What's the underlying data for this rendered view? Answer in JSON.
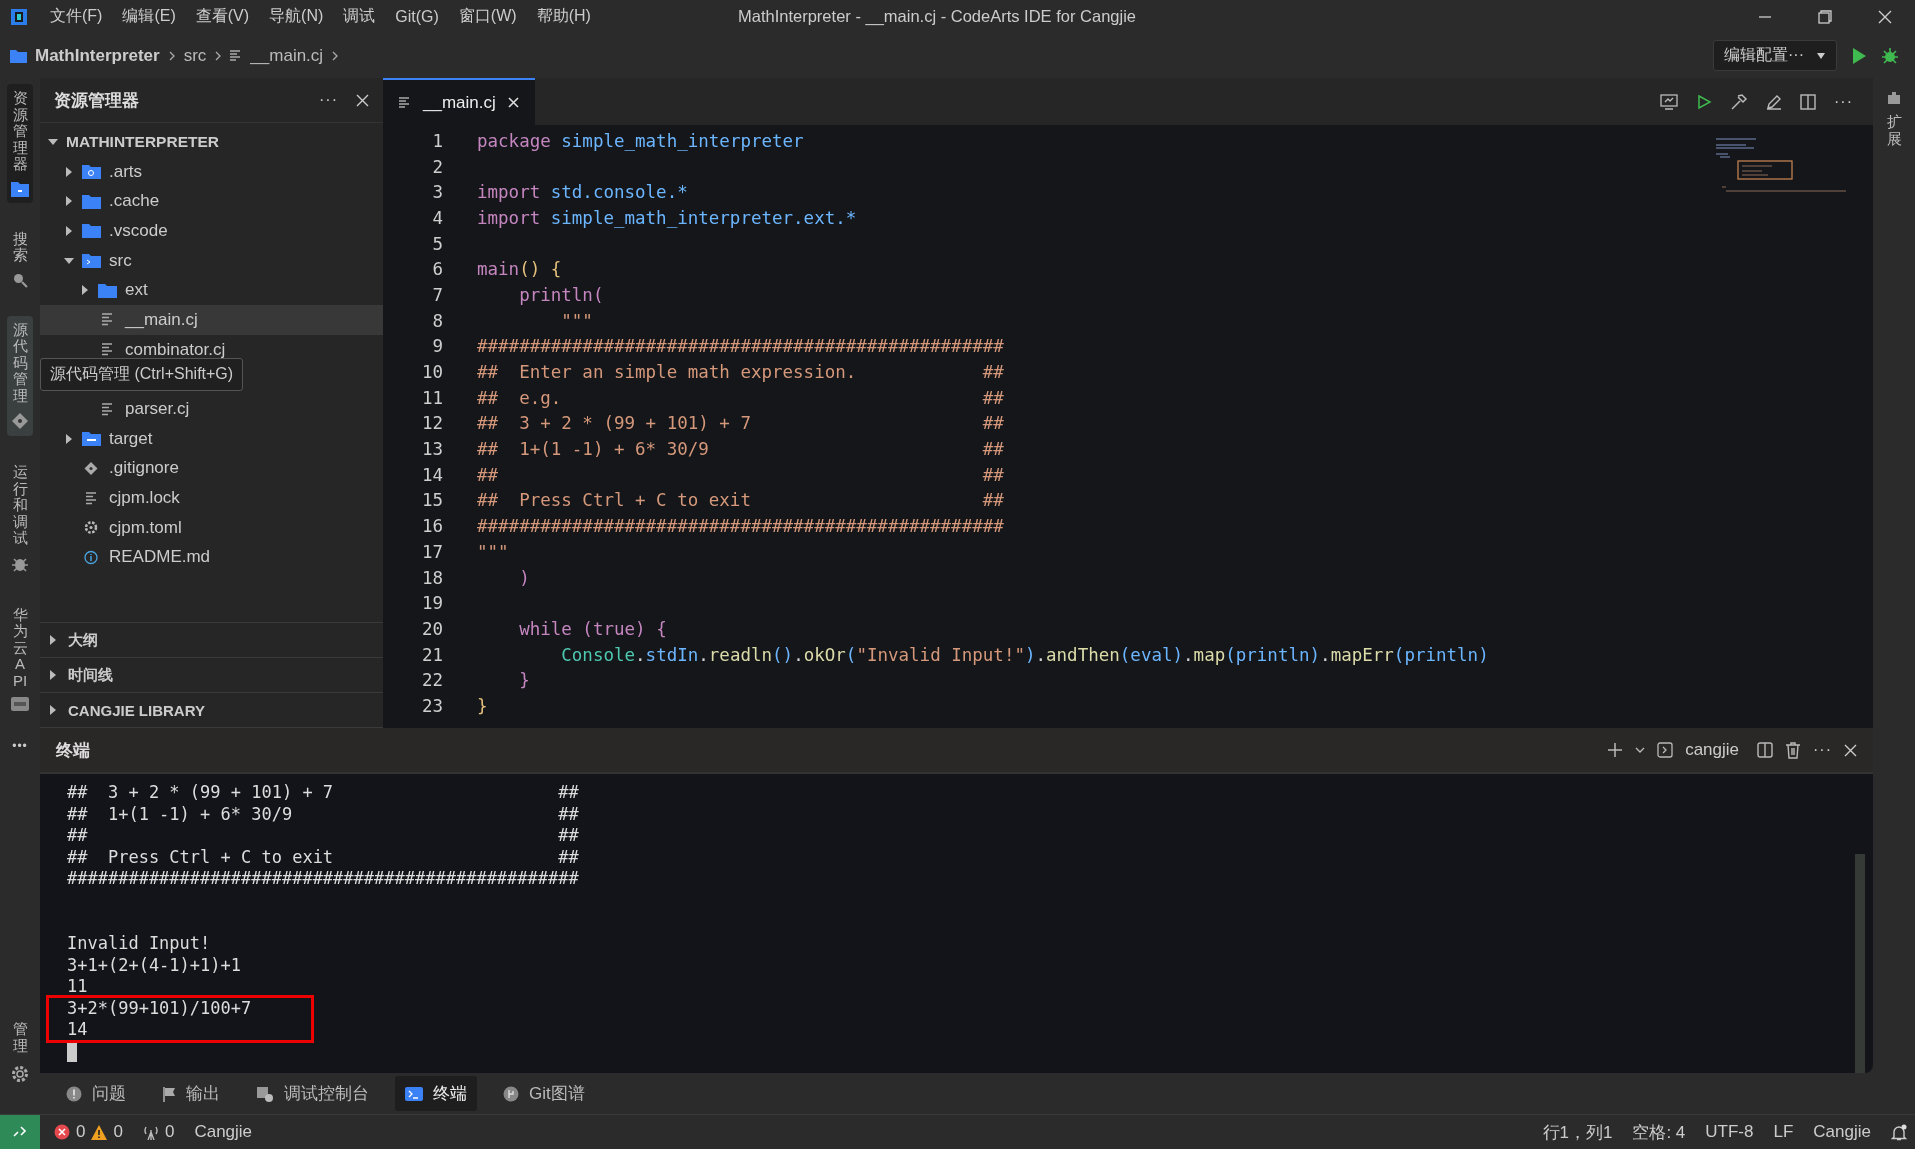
{
  "title_bar": {
    "menus": [
      "文件(F)",
      "编辑(E)",
      "查看(V)",
      "导航(N)",
      "调试",
      "Git(G)",
      "窗口(W)",
      "帮助(H)"
    ],
    "title": "MathInterpreter - __main.cj - CodeArts IDE for Cangjie"
  },
  "breadcrumb": {
    "items": [
      {
        "label": "MathInterpreter",
        "kind": "project"
      },
      {
        "label": "src",
        "kind": "folder"
      },
      {
        "label": "__main.cj",
        "kind": "file"
      }
    ],
    "config_button": "编辑配置···"
  },
  "activity_bar": {
    "items": [
      {
        "label": "资源管理器",
        "selected": true,
        "hovered": false
      },
      {
        "label": "搜索",
        "selected": false,
        "hovered": false
      },
      {
        "label": "源代码管理",
        "selected": false,
        "hovered": true
      },
      {
        "label": "运行和调试",
        "selected": false,
        "hovered": false
      },
      {
        "label": "华为云 API",
        "selected": false,
        "hovered": false
      }
    ],
    "more": "•••",
    "bottom": {
      "label": "管理"
    },
    "tooltip": "源代码管理 (Ctrl+Shift+G)"
  },
  "right_bar": {
    "label": "扩展"
  },
  "explorer": {
    "title": "资源管理器",
    "more": "···",
    "root": {
      "label": "MATHINTERPRETER",
      "expanded": true,
      "children": [
        {
          "label": ".arts",
          "kind": "folder-arts",
          "expanded": false,
          "selected": false
        },
        {
          "label": ".cache",
          "kind": "folder",
          "expanded": false,
          "selected": false
        },
        {
          "label": ".vscode",
          "kind": "folder",
          "expanded": false,
          "selected": false
        },
        {
          "label": "src",
          "kind": "folder-src",
          "expanded": true,
          "selected": false,
          "children": [
            {
              "label": "ext",
              "kind": "folder",
              "expanded": false,
              "selected": false
            },
            {
              "label": "__main.cj",
              "kind": "file",
              "selected": true
            },
            {
              "label": "combinator.cj",
              "kind": "file",
              "selected": false
            },
            {
              "kind": "covered"
            },
            {
              "label": "parser.cj",
              "kind": "file",
              "selected": false
            }
          ]
        },
        {
          "label": "target",
          "kind": "folder-target",
          "expanded": false,
          "selected": false
        },
        {
          "label": ".gitignore",
          "kind": "git",
          "selected": false
        },
        {
          "label": "cjpm.lock",
          "kind": "file",
          "selected": false
        },
        {
          "label": "cjpm.toml",
          "kind": "gear",
          "selected": false
        },
        {
          "label": "README.md",
          "kind": "info",
          "selected": false
        }
      ]
    },
    "sections": [
      {
        "label": "大纲",
        "expanded": false
      },
      {
        "label": "时间线",
        "expanded": false
      },
      {
        "label": "CANGJIE LIBRARY",
        "expanded": false
      }
    ]
  },
  "editor": {
    "tabs": [
      {
        "label": "__main.cj",
        "selected": true
      }
    ],
    "more": "···",
    "lines": [
      {
        "number": "1",
        "tokens": [
          {
            "text": "package",
            "kind": "keyword"
          },
          {
            "text": " simple_math_interpreter",
            "kind": "ident"
          }
        ]
      },
      {
        "number": "2"
      },
      {
        "number": "3",
        "tokens": [
          {
            "text": "import",
            "kind": "keyword"
          },
          {
            "text": " std.console.*",
            "kind": "ident"
          }
        ]
      },
      {
        "number": "4",
        "tokens": [
          {
            "text": "import",
            "kind": "keyword"
          },
          {
            "text": " simple_math_interpreter.ext.*",
            "kind": "ident"
          }
        ]
      },
      {
        "number": "5"
      },
      {
        "number": "6",
        "tokens": [
          {
            "text": "main",
            "kind": "keyword"
          },
          {
            "text": "() {",
            "kind": "bracket"
          }
        ]
      },
      {
        "number": "7",
        "tokens": [
          {
            "text": "    println",
            "kind": "keyword"
          },
          {
            "text": "(",
            "kind": "bracket2"
          }
        ]
      },
      {
        "number": "8",
        "tokens": [
          {
            "text": "        \"\"\"",
            "kind": "string"
          }
        ]
      },
      {
        "number": "9",
        "tokens": [
          {
            "text": "##################################################",
            "kind": "string"
          }
        ]
      },
      {
        "number": "10",
        "tokens": [
          {
            "text": "##  Enter an simple math expression.            ##",
            "kind": "string"
          }
        ]
      },
      {
        "number": "11",
        "tokens": [
          {
            "text": "##  e.g.                                        ##",
            "kind": "string"
          }
        ]
      },
      {
        "number": "12",
        "tokens": [
          {
            "text": "##  3 + 2 * (99 + 101) + 7                      ##",
            "kind": "string"
          }
        ]
      },
      {
        "number": "13",
        "tokens": [
          {
            "text": "##  1+(1 -1) + 6* 30/9                          ##",
            "kind": "string"
          }
        ]
      },
      {
        "number": "14",
        "tokens": [
          {
            "text": "##                                              ##",
            "kind": "string"
          }
        ]
      },
      {
        "number": "15",
        "tokens": [
          {
            "text": "##  Press Ctrl + C to exit                      ##",
            "kind": "string"
          }
        ]
      },
      {
        "number": "16",
        "tokens": [
          {
            "text": "##################################################",
            "kind": "string"
          }
        ]
      },
      {
        "number": "17",
        "tokens": [
          {
            "text": "\"\"\"",
            "kind": "string"
          }
        ]
      },
      {
        "number": "18",
        "tokens": [
          {
            "text": "    )",
            "kind": "bracket2"
          }
        ]
      },
      {
        "number": "19"
      },
      {
        "number": "20",
        "tokens": [
          {
            "text": "    while",
            "kind": "keyword"
          },
          {
            "text": " (",
            "kind": "bracket2"
          },
          {
            "text": "true",
            "kind": "keyword"
          },
          {
            "text": ") {",
            "kind": "bracket2"
          }
        ]
      },
      {
        "number": "21",
        "tokens": [
          {
            "text": "        Console",
            "kind": "type"
          },
          {
            "text": ".",
            "kind": "plain"
          },
          {
            "text": "stdIn",
            "kind": "ident"
          },
          {
            "text": ".",
            "kind": "plain"
          },
          {
            "text": "readln",
            "kind": "func"
          },
          {
            "text": "()",
            "kind": "bracket3"
          },
          {
            "text": ".",
            "kind": "plain"
          },
          {
            "text": "okOr",
            "kind": "func"
          },
          {
            "text": "(",
            "kind": "bracket3"
          },
          {
            "text": "\"Invalid Input!\"",
            "kind": "string"
          },
          {
            "text": ")",
            "kind": "bracket3"
          },
          {
            "text": ".",
            "kind": "plain"
          },
          {
            "text": "andThen",
            "kind": "func"
          },
          {
            "text": "(",
            "kind": "bracket3"
          },
          {
            "text": "eval",
            "kind": "ident"
          },
          {
            "text": ")",
            "kind": "bracket3"
          },
          {
            "text": ".",
            "kind": "plain"
          },
          {
            "text": "map",
            "kind": "func"
          },
          {
            "text": "(",
            "kind": "bracket3"
          },
          {
            "text": "println",
            "kind": "ident"
          },
          {
            "text": ")",
            "kind": "bracket3"
          },
          {
            "text": ".",
            "kind": "plain"
          },
          {
            "text": "mapErr",
            "kind": "func"
          },
          {
            "text": "(",
            "kind": "bracket3"
          },
          {
            "text": "println",
            "kind": "ident"
          },
          {
            "text": ")",
            "kind": "bracket3"
          }
        ]
      },
      {
        "number": "22",
        "tokens": [
          {
            "text": "    }",
            "kind": "bracket2"
          }
        ]
      },
      {
        "number": "23",
        "tokens": [
          {
            "text": "}",
            "kind": "bracket"
          }
        ]
      }
    ]
  },
  "terminal": {
    "title": "终端",
    "shell": "cangjie",
    "more": "···",
    "banner": [
      "##  3 + 2 * (99 + 101) + 7                      ##",
      "##  1+(1 -1) + 6* 30/9                          ##",
      "##                                              ##",
      "##  Press Ctrl + C to exit                      ##",
      "##################################################"
    ],
    "session": [
      "Invalid Input!",
      "3+1+(2+(4-1)+1)+1",
      "11"
    ],
    "boxed": [
      "3+2*(99+101)/100+7",
      "14"
    ]
  },
  "panel_tabs": [
    {
      "label": "问题",
      "selected": false
    },
    {
      "label": "输出",
      "selected": false
    },
    {
      "label": "调试控制台",
      "selected": false
    },
    {
      "label": "终端",
      "selected": true
    },
    {
      "label": "Git图谱",
      "selected": false
    }
  ],
  "status_bar": {
    "errors": "0",
    "warnings": "0",
    "ports": "0",
    "language_left": "Cangjie",
    "position": "行1，列1",
    "indent": "空格: 4",
    "encoding": "UTF-8",
    "eol": "LF",
    "language": "Cangjie"
  }
}
